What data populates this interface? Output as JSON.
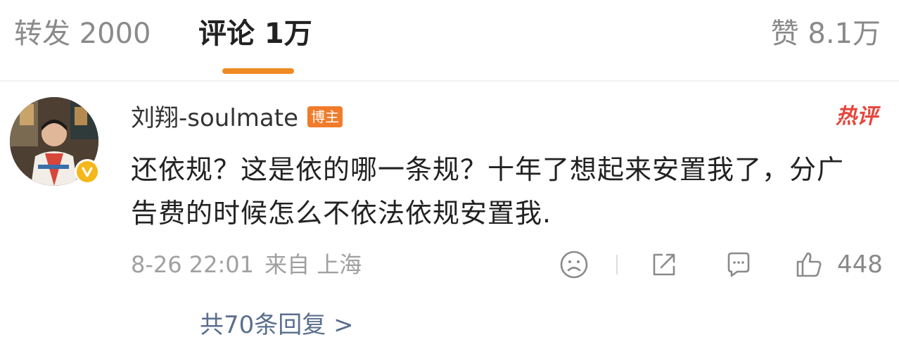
{
  "tabs": {
    "repost": "转发 2000",
    "comment": "评论 1万",
    "like": "赞 8.1万"
  },
  "comment": {
    "author": "刘翔-soulmate",
    "badge": "博主",
    "hot_label": "热评",
    "text": "还依规？这是依的哪一条规？十年了想起来安置我了，分广告费的时候怎么不依法依规安置我.",
    "date": "8-26 22:01",
    "source": "来自 上海",
    "like_count": "448",
    "replies_link": "共70条回复 >",
    "icons": [
      "emoji-sad-icon",
      "share-icon",
      "reply-icon",
      "thumbs-up-icon",
      "verified-icon"
    ],
    "colors": {
      "accent": "#f08a24",
      "hot": "#e4473b",
      "link": "#5a6f8e",
      "verified": "#f5b71a",
      "badge": "#f07b2a"
    }
  }
}
